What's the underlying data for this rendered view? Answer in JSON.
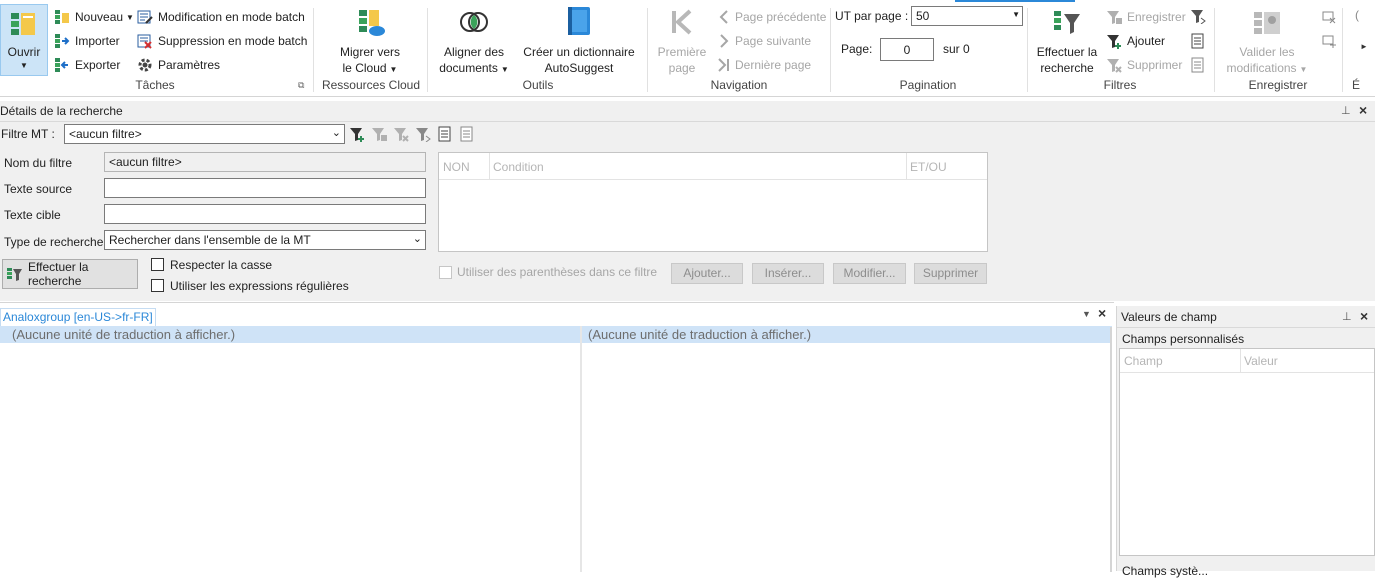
{
  "ribbon": {
    "taches": {
      "open": "Ouvrir",
      "new": "Nouveau",
      "import": "Importer",
      "export": "Exporter",
      "batch_edit": "Modification en mode batch",
      "batch_delete": "Suppression en mode batch",
      "settings": "Paramètres",
      "label": "Tâches"
    },
    "cloud": {
      "migrate_line1": "Migrer vers",
      "migrate_line2": "le Cloud",
      "label": "Ressources Cloud"
    },
    "outils": {
      "align_line1": "Aligner des",
      "align_line2": "documents",
      "dict_line1": "Créer un dictionnaire",
      "dict_line2": "AutoSuggest",
      "label": "Outils"
    },
    "navigation": {
      "first_line1": "Première",
      "first_line2": "page",
      "prev": "Page précédente",
      "next": "Page suivante",
      "last": "Dernière page",
      "label": "Navigation"
    },
    "pagination": {
      "per_page_label": "UT par page :",
      "per_page_value": "50",
      "page_label": "Page:",
      "page_value": "0",
      "of_label": "sur 0",
      "label": "Pagination"
    },
    "filtres": {
      "search_line1": "Effectuer la",
      "search_line2": "recherche",
      "save": "Enregistrer",
      "add": "Ajouter",
      "delete": "Supprimer",
      "label": "Filtres"
    },
    "enregistrer": {
      "validate_line1": "Valider les",
      "validate_line2": "modifications",
      "label": "Enregistrer",
      "overflow": "É"
    }
  },
  "search_panel": {
    "title": "Détails de la recherche",
    "filter_label": "Filtre MT :",
    "filter_value": "<aucun filtre>",
    "name_label": "Nom du filtre",
    "name_value": "<aucun filtre>",
    "source_label": "Texte source",
    "target_label": "Texte cible",
    "type_label": "Type de recherche",
    "type_value": "Rechercher dans l'ensemble de la MT",
    "search_button": "Effectuer la recherche",
    "match_case": "Respecter la casse",
    "regex": "Utiliser les expressions régulières",
    "cond_cols": [
      "NON",
      "Condition",
      "ET/OU"
    ],
    "parentheses": "Utiliser des parenthèses dans ce filtre",
    "btn_add": "Ajouter...",
    "btn_insert": "Insérer...",
    "btn_modify": "Modifier...",
    "btn_delete": "Supprimer"
  },
  "editor": {
    "tab": "Analoxgroup [en-US->fr-FR]",
    "left_msg": "(Aucune unité de traduction à afficher.)",
    "right_msg": "(Aucune unité de traduction à afficher.)"
  },
  "fields_panel": {
    "title": "Valeurs de champ",
    "subtitle": "Champs personnalisés",
    "col_field": "Champ",
    "col_value": "Valeur",
    "bottom_cut": "Champs systè..."
  },
  "colors": {
    "accent": "#2b88d8",
    "row_highlight": "#cfe3f7",
    "disabled": "#a6a6a6"
  }
}
